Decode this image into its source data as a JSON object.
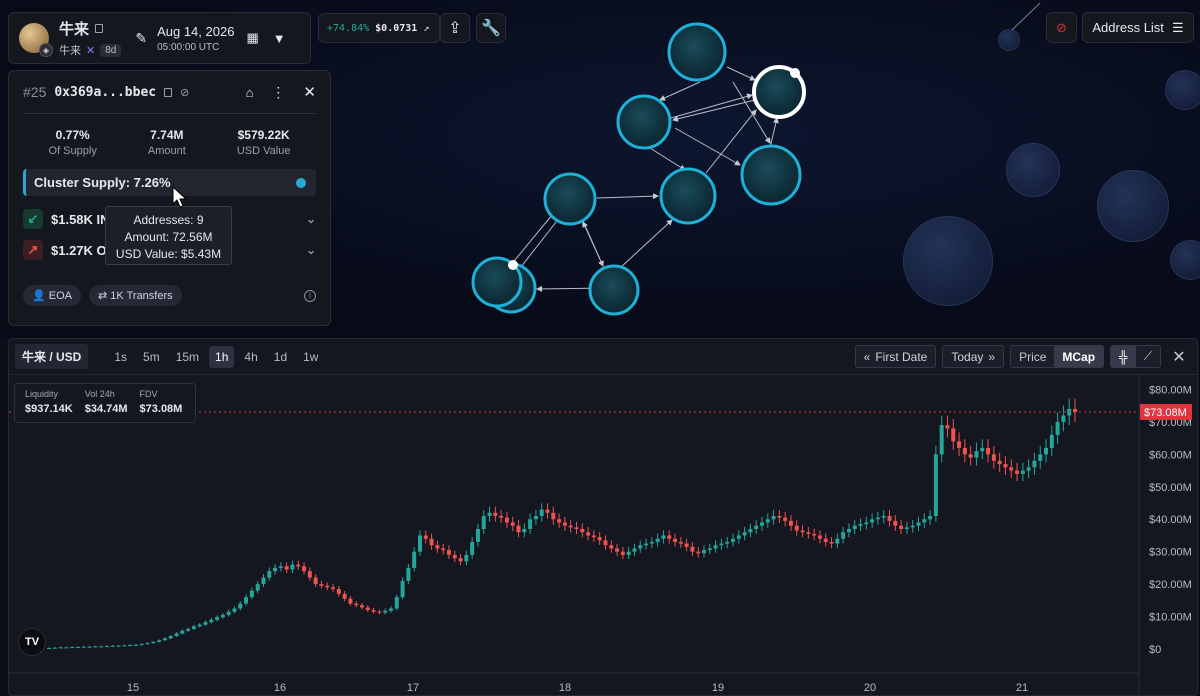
{
  "token": {
    "name": "牛来",
    "symbol": "牛来",
    "age": "8d",
    "date": "Aug 14, 2026",
    "time": "05:00:00 UTC"
  },
  "price_chip": {
    "change": "+74.84%",
    "price": "$0.0731"
  },
  "address_list_label": "Address List",
  "address": {
    "index": "#25",
    "short": "0x369a...bbec",
    "stats": [
      {
        "value": "0.77%",
        "label": "Of Supply"
      },
      {
        "value": "7.74M",
        "label": "Amount"
      },
      {
        "value": "$579.22K",
        "label": "USD Value"
      }
    ],
    "cluster_supply": "Cluster Supply: 7.26%",
    "inflow": "$1.58K IN",
    "outflow": "$1.27K OU",
    "tags": [
      "EOA",
      "1K Transfers"
    ]
  },
  "tooltip": {
    "addresses": "Addresses: 9",
    "amount": "Amount: 72.56M",
    "usd": "USD Value: $5.43M"
  },
  "chart_toolbar": {
    "pair": "牛来 / USD",
    "timeframes": [
      "1s",
      "5m",
      "15m",
      "1h",
      "4h",
      "1d",
      "1w"
    ],
    "active_tf": "1h",
    "first_date": "First Date",
    "today": "Today",
    "price": "Price",
    "mcap": "MCap"
  },
  "legend": {
    "liquidity_label": "Liquidity",
    "liquidity": "$937.14K",
    "vol_label": "Vol 24h",
    "vol": "$34.74M",
    "fdv_label": "FDV",
    "fdv": "$73.08M"
  },
  "colors": {
    "up": "#26a69a",
    "down": "#ef5350",
    "node": "#29a8d6",
    "accent_price": "#e0343e"
  },
  "chart_data": {
    "type": "candlestick",
    "x_ticks": [
      "15",
      "16",
      "17",
      "18",
      "19",
      "20",
      "21"
    ],
    "y_ticks": [
      "$80.00M",
      "$70.00M",
      "$60.00M",
      "$50.00M",
      "$40.00M",
      "$30.00M",
      "$20.00M",
      "$10.00M",
      "$0"
    ],
    "ylim": [
      0,
      82
    ],
    "current_label": "$73.08M",
    "current_value": 73.08,
    "closes_millions": [
      0.3,
      0.4,
      0.5,
      0.5,
      0.6,
      0.6,
      0.7,
      0.7,
      0.8,
      0.8,
      0.9,
      1.0,
      1.0,
      1.1,
      1.2,
      1.3,
      1.5,
      1.8,
      2.2,
      2.7,
      3.3,
      4.0,
      4.8,
      5.6,
      6.2,
      7.0,
      7.5,
      8.3,
      9.0,
      9.8,
      10.5,
      11.5,
      12.5,
      14.0,
      16.0,
      18.0,
      20.0,
      22.0,
      24.0,
      25.0,
      25.5,
      24.5,
      26.0,
      25.5,
      24.0,
      22.0,
      20.0,
      19.5,
      19.0,
      18.5,
      17.0,
      15.5,
      14.0,
      13.5,
      12.8,
      12.0,
      11.5,
      11.2,
      11.8,
      12.5,
      16.0,
      21.0,
      25.0,
      30.0,
      35.0,
      34.0,
      32.0,
      31.0,
      30.5,
      29.0,
      28.0,
      27.0,
      29.0,
      33.0,
      37.0,
      41.0,
      42.0,
      41.0,
      40.5,
      39.0,
      38.0,
      36.0,
      37.0,
      40.0,
      41.0,
      43.0,
      42.0,
      40.0,
      39.0,
      38.0,
      37.5,
      37.0,
      36.0,
      35.0,
      34.5,
      33.5,
      32.0,
      31.0,
      30.0,
      29.0,
      30.0,
      31.0,
      32.0,
      32.5,
      33.0,
      34.0,
      35.0,
      34.0,
      33.0,
      32.5,
      31.5,
      30.0,
      29.5,
      30.5,
      31.0,
      32.0,
      32.5,
      33.0,
      34.0,
      35.0,
      36.0,
      37.0,
      38.0,
      39.0,
      40.0,
      41.0,
      40.5,
      39.5,
      38.0,
      36.5,
      36.0,
      35.5,
      35.0,
      34.0,
      33.0,
      32.5,
      34.0,
      36.0,
      37.0,
      38.0,
      38.5,
      39.0,
      40.0,
      40.5,
      41.0,
      39.5,
      38.0,
      37.0,
      37.5,
      38.0,
      39.0,
      40.0,
      41.0,
      60.0,
      69.0,
      68.0,
      64.0,
      62.0,
      60.0,
      59.0,
      61.0,
      62.0,
      60.0,
      58.0,
      57.0,
      56.0,
      55.0,
      54.0,
      55.0,
      56.0,
      58.0,
      60.0,
      62.0,
      66.0,
      70.0,
      72.0,
      74.0,
      73.0
    ]
  }
}
